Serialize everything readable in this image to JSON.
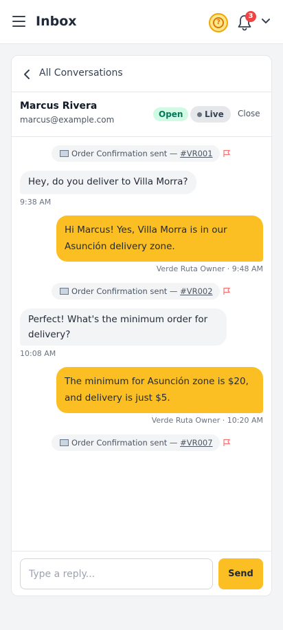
{
  "header": {
    "title": "Inbox",
    "menu_icon": "hamburger-menu-icon",
    "help_icon": "question-circle-icon",
    "notifications_icon": "bell-icon",
    "notification_count": "3",
    "account_icon": "chevron-down-icon"
  },
  "conversation": {
    "back_label": "All Conversations",
    "contact_name": "Marcus Rivera",
    "contact_email": "marcus@example.com",
    "status_badge": "Open",
    "live_badge": "Live",
    "close_label": "Close"
  },
  "messages": [
    {
      "type": "system",
      "text": "Order Confirmation sent — ",
      "ref": "#VR001"
    },
    {
      "type": "incoming",
      "text": "Hey, do you deliver to Villa Morra?",
      "meta": "9:38 AM"
    },
    {
      "type": "outgoing",
      "line1": "Hi Marcus! Yes, Villa Morra is in our",
      "line2": "Asunción delivery zone.",
      "meta": "Verde Ruta Owner · 9:48 AM"
    },
    {
      "type": "system",
      "text": "Order Confirmation sent — ",
      "ref": "#VR002"
    },
    {
      "type": "incoming",
      "line1": "Perfect! What's the minimum order for",
      "line2": "delivery?",
      "meta": "10:08 AM"
    },
    {
      "type": "outgoing",
      "line1": "The minimum for Asunción zone is $20,",
      "line2": "and delivery is just $5.",
      "meta": "Verde Ruta Owner · 10:20 AM"
    },
    {
      "type": "system",
      "text": "Order Confirmation sent — ",
      "ref": "#VR007"
    }
  ],
  "composer": {
    "placeholder": "Type a reply...",
    "send_label": "Send"
  },
  "colors": {
    "accent": "#fbbf24",
    "open_badge_bg": "#d1fae5",
    "notification_badge": "#ef4444",
    "flag": "#f87171"
  }
}
